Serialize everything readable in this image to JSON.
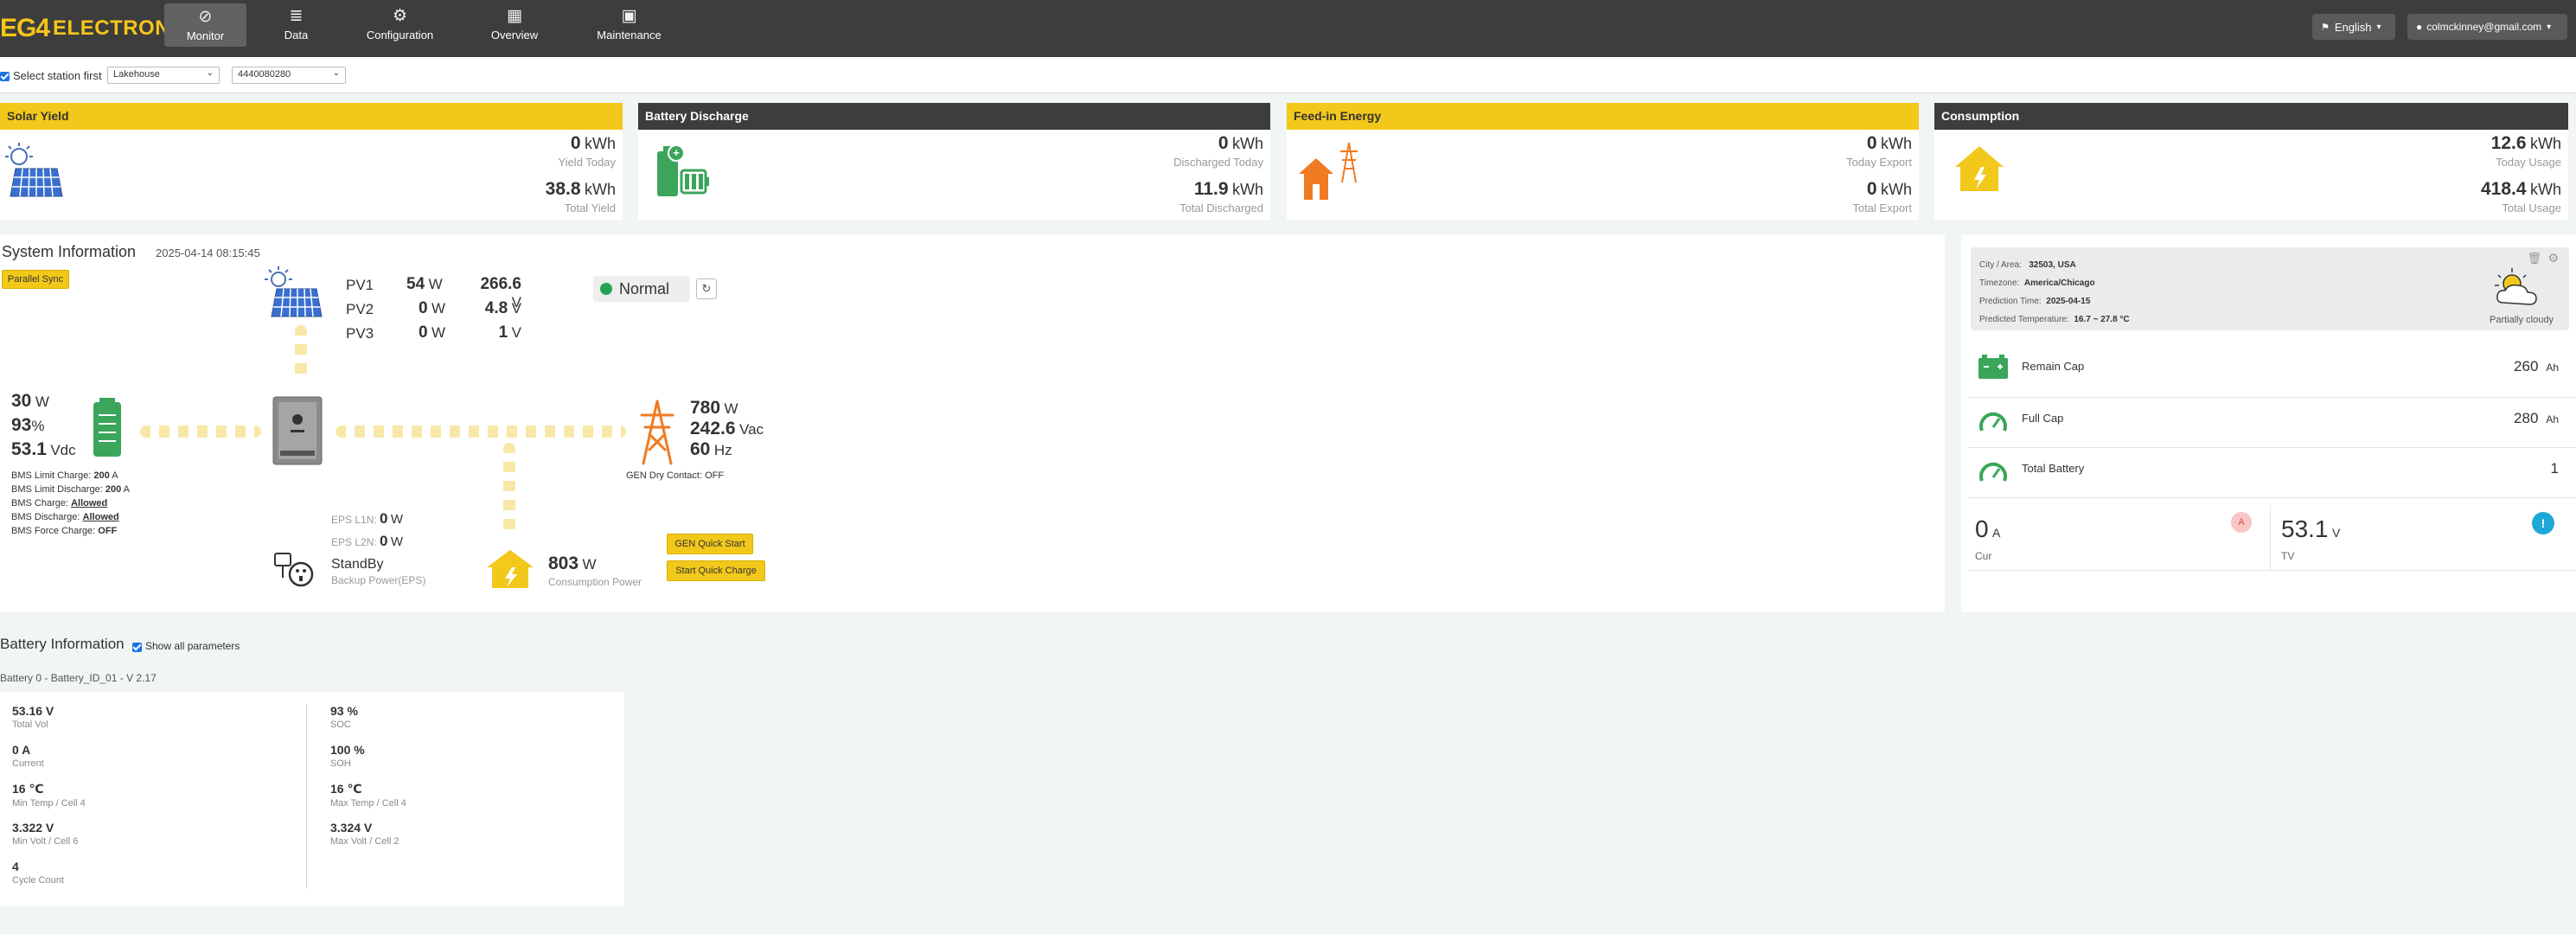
{
  "nav": {
    "logo_eg": "EG4",
    "logo_text": "ELECTRONICS",
    "items": [
      {
        "label": "Monitor",
        "icon": "compass-icon"
      },
      {
        "label": "Data",
        "icon": "database-icon"
      },
      {
        "label": "Configuration",
        "icon": "gear-icon"
      },
      {
        "label": "Overview",
        "icon": "grid-icon"
      },
      {
        "label": "Maintenance",
        "icon": "briefcase-icon"
      }
    ],
    "language": "English",
    "user": "colmckinney@gmail.com"
  },
  "station": {
    "checkbox_label": "Select station first",
    "station_value": "Lakehouse",
    "serial_value": "4440080280"
  },
  "cards": {
    "solar": {
      "title": "Solar Yield",
      "today_value": "0",
      "today_unit": "kWh",
      "today_label": "Yield Today",
      "total_value": "38.8",
      "total_unit": "kWh",
      "total_label": "Total Yield"
    },
    "discharge": {
      "title": "Battery Discharge",
      "today_value": "0",
      "today_unit": "kWh",
      "today_label": "Discharged Today",
      "total_value": "11.9",
      "total_unit": "kWh",
      "total_label": "Total Discharged"
    },
    "feedin": {
      "title": "Feed-in Energy",
      "today_value": "0",
      "today_unit": "kWh",
      "today_label": "Today Export",
      "total_value": "0",
      "total_unit": "kWh",
      "total_label": "Total Export"
    },
    "consumption": {
      "title": "Consumption",
      "today_value": "12.6",
      "today_unit": "kWh",
      "today_label": "Today Usage",
      "total_value": "418.4",
      "total_unit": "kWh",
      "total_label": "Total Usage"
    }
  },
  "system": {
    "title": "System Information",
    "timestamp": "2025-04-14 08:15:45",
    "parallel_button": "Parallel Sync",
    "pv": [
      {
        "name": "PV1",
        "w": "54",
        "v": "266.6"
      },
      {
        "name": "PV2",
        "w": "0",
        "v": "4.8"
      },
      {
        "name": "PV3",
        "w": "0",
        "v": "1"
      }
    ],
    "w_unit": "W",
    "v_unit": "V",
    "status": "Normal",
    "battery": {
      "power": "30",
      "power_unit": "W",
      "soc": "93",
      "soc_unit": "%",
      "voltage": "53.1",
      "voltage_unit": "Vdc"
    },
    "bms": [
      {
        "label": "BMS Limit Charge:",
        "value": "200",
        "unit": "A"
      },
      {
        "label": "BMS Limit Discharge:",
        "value": "200",
        "unit": "A"
      },
      {
        "label": "BMS Charge:",
        "value": "Allowed",
        "unit": ""
      },
      {
        "label": "BMS Discharge:",
        "value": "Allowed",
        "unit": ""
      },
      {
        "label": "BMS Force Charge:",
        "value": "OFF",
        "unit": ""
      }
    ],
    "grid": {
      "power": "780",
      "power_unit": "W",
      "voltage": "242.6",
      "voltage_unit": "Vac",
      "freq": "60",
      "freq_unit": "Hz",
      "gen_contact": "GEN Dry Contact: OFF"
    },
    "eps": {
      "l1_label": "EPS L1N:",
      "l1_value": "0",
      "l2_label": "EPS L2N:",
      "l2_value": "0",
      "unit": "W",
      "status": "StandBy",
      "label": "Backup Power(EPS)"
    },
    "consumption": {
      "value": "803",
      "unit": "W",
      "label": "Consumption Power"
    },
    "gen_button": "GEN Quick Start",
    "charge_button": "Start Quick Charge"
  },
  "weather": {
    "city_label": "City / Area:",
    "city": "32503, USA",
    "tz_label": "Timezone:",
    "tz": "America/Chicago",
    "pred_label": "Prediction Time:",
    "pred": "2025-04-15",
    "temp_label": "Predicted Temperature:",
    "temp": "16.7 ~ 27.8 °C",
    "condition": "Partially cloudy"
  },
  "battery_stats": {
    "remain_label": "Remain Cap",
    "remain_value": "260",
    "remain_unit": "Ah",
    "full_label": "Full Cap",
    "full_value": "280",
    "full_unit": "Ah",
    "total_label": "Total Battery",
    "total_value": "1",
    "cur_value": "0",
    "cur_unit": "A",
    "cur_label": "Cur",
    "cur_badge": "A",
    "tv_value": "53.1",
    "tv_unit": "V",
    "tv_label": "TV",
    "tv_badge": "!"
  },
  "battery_info": {
    "title": "Battery Information",
    "show_all": "Show all parameters",
    "battery_id": "Battery 0 - Battery_ID_01 - V 2.17",
    "left": [
      {
        "value": "53.16 V",
        "label": "Total Vol"
      },
      {
        "value": "0 A",
        "label": "Current"
      },
      {
        "value": "16 ℃",
        "label": "Min Temp / Cell 4"
      },
      {
        "value": "3.322 V",
        "label": "Min Volt / Cell 6"
      },
      {
        "value": "4",
        "label": "Cycle Count"
      }
    ],
    "right": [
      {
        "value": "93 %",
        "label": "SOC"
      },
      {
        "value": "100 %",
        "label": "SOH"
      },
      {
        "value": "16 ℃",
        "label": "Max Temp / Cell 4"
      },
      {
        "value": "3.324 V",
        "label": "Max Volt / Cell 2"
      }
    ]
  },
  "colors": {
    "accent_yellow": "#f2c81b",
    "dark": "#3d3d3d",
    "green": "#3aa55b",
    "orange": "#f07b22"
  }
}
